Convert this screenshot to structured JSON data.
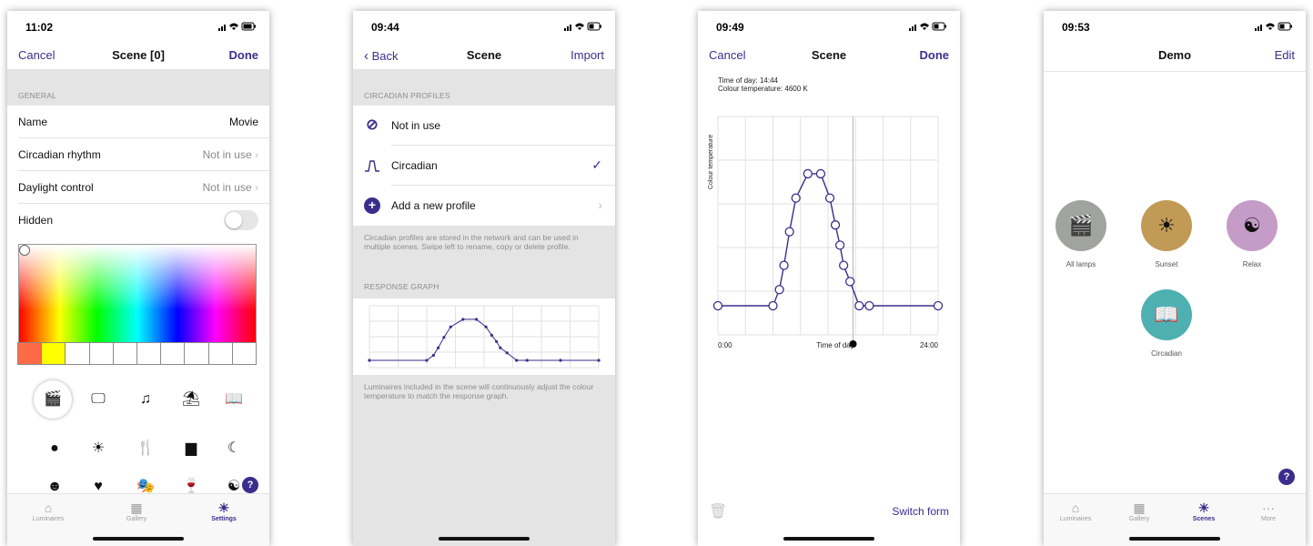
{
  "phone1": {
    "time": "11:02",
    "nav": {
      "cancel": "Cancel",
      "title": "Scene [0]",
      "done": "Done"
    },
    "section_general": "GENERAL",
    "rows": [
      {
        "label": "Name",
        "value": "Movie"
      },
      {
        "label": "Circadian rhythm",
        "value": "Not in use"
      },
      {
        "label": "Daylight control",
        "value": "Not in use"
      }
    ],
    "hidden_label": "Hidden",
    "hidden_on": false,
    "swatch_colors": [
      "#ff6a47",
      "#ffff00",
      "#ffffff",
      "#ffffff",
      "#ffffff",
      "#ffffff",
      "#ffffff",
      "#ffffff",
      "#ffffff",
      "#ffffff"
    ],
    "icons": [
      "clapperboard-icon",
      "presentation-icon",
      "music-note-icon",
      "desk-lamp-icon",
      "book-icon",
      "clock-icon",
      "sun-icon",
      "fork-knife-icon",
      "bed-icon",
      "moon-icon",
      "mask-icon",
      "heart-icon",
      "theater-masks-icon",
      "wine-glass-icon",
      "yin-yang-icon"
    ],
    "help": "?",
    "tabs": [
      {
        "label": "Luminaires",
        "icon": "luminaire-icon",
        "active": false
      },
      {
        "label": "Gallery",
        "icon": "gallery-icon",
        "active": false
      },
      {
        "label": "Settings",
        "icon": "sun-icon",
        "active": true
      }
    ]
  },
  "phone2": {
    "time": "09:44",
    "nav": {
      "back": "Back",
      "title": "Scene",
      "import": "Import"
    },
    "section_profiles": "CIRCADIAN PROFILES",
    "profiles": [
      {
        "label": "Not in use",
        "icon": "not-in-use-icon",
        "checked": false
      },
      {
        "label": "Circadian",
        "icon": "circadian-icon",
        "checked": true
      },
      {
        "label": "Add a new profile",
        "icon": "plus-icon",
        "checked": false
      }
    ],
    "profiles_note": "Circadian profiles are stored in the network and can be used in multiple scenes. Swipe left to rename, copy or delete profile.",
    "section_response": "RESPONSE GRAPH",
    "response_note": "Luminaires included in the scene will continuously adjust the colour temperature to match the response graph."
  },
  "phone3": {
    "time": "09:49",
    "nav": {
      "cancel": "Cancel",
      "title": "Scene",
      "done": "Done"
    },
    "time_of_day_text": "Time of day: 14:44",
    "colour_temp_text": "Colour temperature: 4600 K",
    "y_axis_label": "Colour temperature",
    "x_axis_label": "Time of day",
    "x_start": "0:00",
    "x_end": "24:00",
    "switch_form": "Switch form"
  },
  "phone4": {
    "time": "09:53",
    "nav": {
      "title": "Demo",
      "edit": "Edit"
    },
    "scenes": [
      {
        "label": "All lamps",
        "icon": "clapperboard-icon",
        "color": "#a0a39e"
      },
      {
        "label": "Sunset",
        "icon": "sun-icon",
        "color": "#c19a56"
      },
      {
        "label": "Relax",
        "icon": "yin-yang-icon",
        "color": "#c59bc8"
      },
      {
        "label": "Circadian",
        "icon": "book-icon",
        "color": "#4fb0b1"
      }
    ],
    "help": "?",
    "tabs": [
      {
        "label": "Luminaires",
        "icon": "luminaire-icon",
        "active": false
      },
      {
        "label": "Gallery",
        "icon": "gallery-icon",
        "active": false
      },
      {
        "label": "Scenes",
        "icon": "sun-icon",
        "active": true
      },
      {
        "label": "More",
        "icon": "more-icon",
        "active": false
      }
    ]
  },
  "chart_data": [
    {
      "type": "line",
      "x_ticks": [
        "0:00",
        "24:00"
      ],
      "xlabel": "Time of day",
      "ylabel": "Colour temperature",
      "x": [
        0,
        6,
        6.7,
        7.2,
        7.8,
        8.5,
        9.8,
        11.2,
        12.2,
        12.8,
        13.3,
        13.7,
        14.4,
        15.4,
        16.5,
        20,
        24
      ],
      "y": [
        0.0,
        0.0,
        0.12,
        0.3,
        0.55,
        0.8,
        0.98,
        0.98,
        0.8,
        0.6,
        0.45,
        0.3,
        0.18,
        0.0,
        0.0,
        0.0,
        0.0
      ],
      "cursor_x": 14.73
    }
  ]
}
